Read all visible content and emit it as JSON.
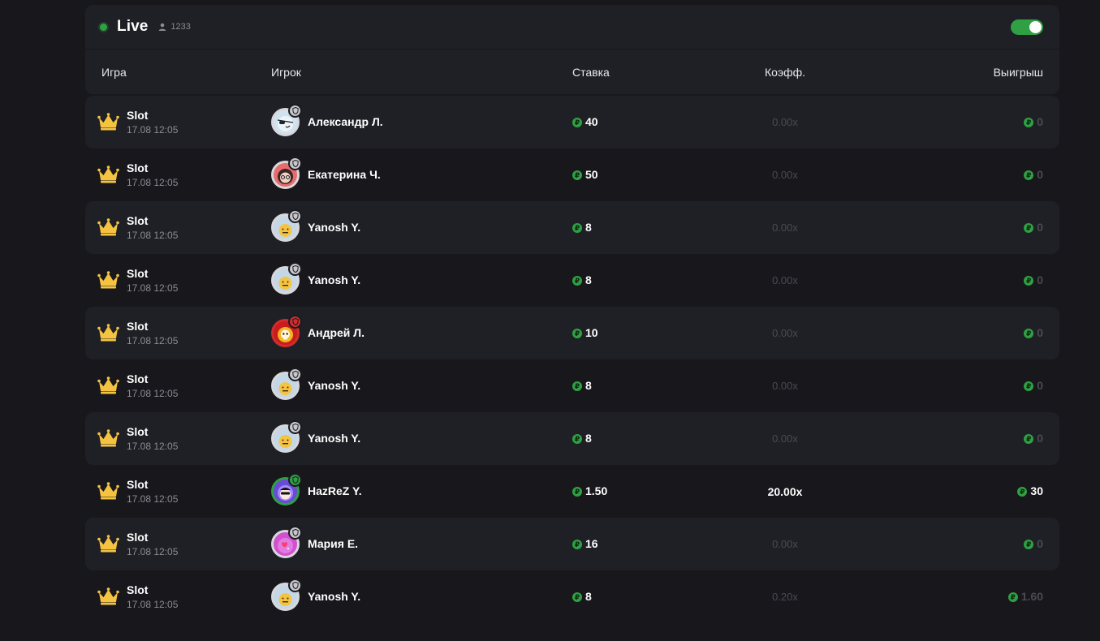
{
  "header": {
    "title": "Live",
    "online_count": "1233",
    "toggle_on": true,
    "accent": "#2fa043"
  },
  "columns": {
    "game": "Игра",
    "player": "Игрок",
    "bet": "Ставка",
    "coef": "Коэфф.",
    "win": "Выигрыш"
  },
  "rows": [
    {
      "game": "Slot",
      "time": "17.08 12:05",
      "player": "Александр Л.",
      "bet": "40",
      "coef": "0.00x",
      "win": "0",
      "avatar": "pirate",
      "badge": "silver",
      "alt": true,
      "hot": false
    },
    {
      "game": "Slot",
      "time": "17.08 12:05",
      "player": "Екатерина Ч.",
      "bet": "50",
      "coef": "0.00x",
      "win": "0",
      "avatar": "girl-glasses",
      "badge": "silver",
      "alt": false,
      "hot": false
    },
    {
      "game": "Slot",
      "time": "17.08 12:05",
      "player": "Yanosh Y.",
      "bet": "8",
      "coef": "0.00x",
      "win": "0",
      "avatar": "smiley",
      "badge": "silver",
      "alt": true,
      "hot": false
    },
    {
      "game": "Slot",
      "time": "17.08 12:05",
      "player": "Yanosh Y.",
      "bet": "8",
      "coef": "0.00x",
      "win": "0",
      "avatar": "smiley",
      "badge": "silver",
      "alt": false,
      "hot": false
    },
    {
      "game": "Slot",
      "time": "17.08 12:05",
      "player": "Андрей Л.",
      "bet": "10",
      "coef": "0.00x",
      "win": "0",
      "avatar": "skull",
      "badge": "red",
      "alt": true,
      "hot": false
    },
    {
      "game": "Slot",
      "time": "17.08 12:05",
      "player": "Yanosh Y.",
      "bet": "8",
      "coef": "0.00x",
      "win": "0",
      "avatar": "smiley",
      "badge": "silver",
      "alt": false,
      "hot": false
    },
    {
      "game": "Slot",
      "time": "17.08 12:05",
      "player": "Yanosh Y.",
      "bet": "8",
      "coef": "0.00x",
      "win": "0",
      "avatar": "smiley",
      "badge": "silver",
      "alt": true,
      "hot": false
    },
    {
      "game": "Slot",
      "time": "17.08 12:05",
      "player": "HazReZ Y.",
      "bet": "1.50",
      "coef": "20.00x",
      "win": "30",
      "avatar": "cool",
      "badge": "green",
      "alt": false,
      "hot": true
    },
    {
      "game": "Slot",
      "time": "17.08 12:05",
      "player": "Мария Е.",
      "bet": "16",
      "coef": "0.00x",
      "win": "0",
      "avatar": "heart",
      "badge": "silver",
      "alt": true,
      "hot": false
    },
    {
      "game": "Slot",
      "time": "17.08 12:05",
      "player": "Yanosh Y.",
      "bet": "8",
      "coef": "0.20x",
      "win": "1.60",
      "avatar": "smiley",
      "badge": "silver",
      "alt": false,
      "hot": false
    }
  ],
  "currency_symbol": "₽",
  "icons": {
    "game": "crown-icon",
    "online": "user-icon",
    "currency": "ruble-coin-icon"
  }
}
